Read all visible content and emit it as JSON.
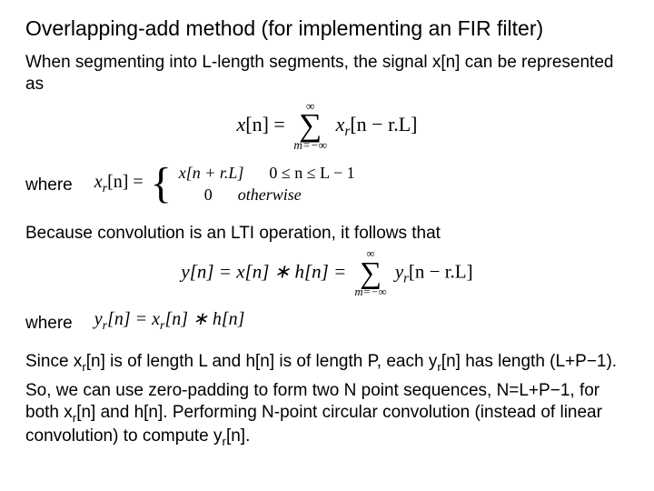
{
  "title": "Overlapping-add method (for implementing an FIR filter)",
  "p1": "When segmenting into L-length segments, the signal x[n] can be represented as",
  "eq1": {
    "lhs_x": "x",
    "lhs_n": "[n] =",
    "sum_top": "∞",
    "sum_sym": "∑",
    "sum_bot": "m=−∞",
    "rhs_x": "x",
    "rhs_sub": "r",
    "rhs_tail": "[n − r.L]"
  },
  "p2": "where",
  "eq2": {
    "lhs_x": "x",
    "lhs_sub": "r",
    "lhs_tail": "[n] =",
    "row1_left": "x[n + r.L]",
    "row1_right": "0 ≤ n ≤ L − 1",
    "row2_left": "0",
    "row2_right": "otherwise"
  },
  "p3": "Because convolution is an LTI operation, it follows that",
  "eq3": {
    "lhs": "y[n] = x[n] ∗ h[n] =",
    "sum_top": "∞",
    "sum_sym": "∑",
    "sum_bot": "m=−∞",
    "rhs_y": "y",
    "rhs_sub": "r",
    "rhs_tail": "[n − r.L]"
  },
  "p4": "where",
  "eq4": {
    "text_pre_y": "y",
    "text_sub1": "r",
    "text_mid": "[n] = x",
    "text_sub2": "r",
    "text_tail": "[n] ∗ h[n]"
  },
  "p5a": "Since x",
  "p5a_sub": "r",
  "p5b": "[n] is of length L and h[n] is of length P, each y",
  "p5b_sub": "r",
  "p5c": "[n] has length (L+P−1).",
  "p6a": "So, we can use zero-padding to form two N point sequences, N=L+P−1, for both x",
  "p6a_sub": "r",
  "p6b": "[n] and h[n]. Performing N-point circular convolution (instead of linear convolution) to compute y",
  "p6b_sub": "r",
  "p6c": "[n]."
}
